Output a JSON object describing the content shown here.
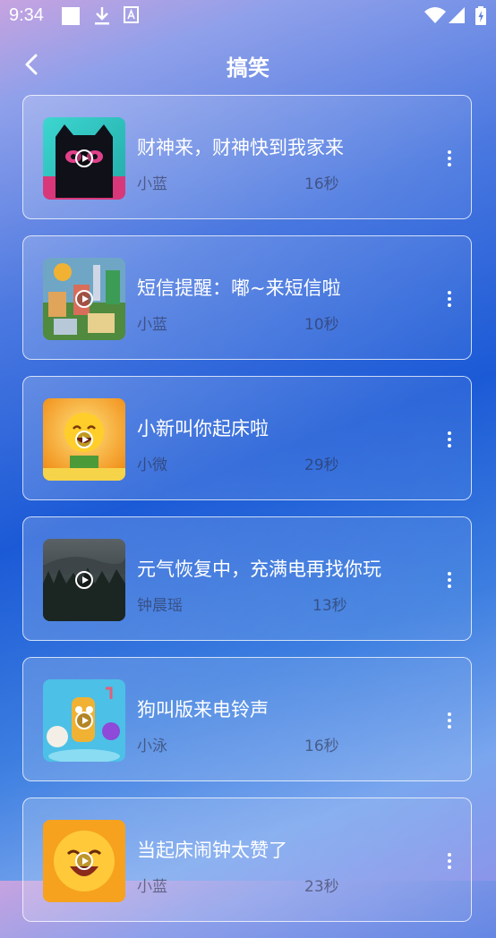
{
  "status_bar": {
    "time": "9:34"
  },
  "header": {
    "title": "搞笑"
  },
  "items": [
    {
      "title": "财神来，财神快到我家来",
      "author": "小蓝",
      "duration": "16秒"
    },
    {
      "title": "短信提醒：嘟~来短信啦",
      "author": "小蓝",
      "duration": "10秒"
    },
    {
      "title": "小新叫你起床啦",
      "author": "小微",
      "duration": "29秒"
    },
    {
      "title": "元气恢复中，充满电再找你玩",
      "author": "钟晨瑶",
      "duration": "13秒"
    },
    {
      "title": "狗叫版来电铃声",
      "author": "小泳",
      "duration": "16秒"
    },
    {
      "title": "当起床闹钟太赞了",
      "author": "小蓝",
      "duration": "23秒"
    }
  ]
}
